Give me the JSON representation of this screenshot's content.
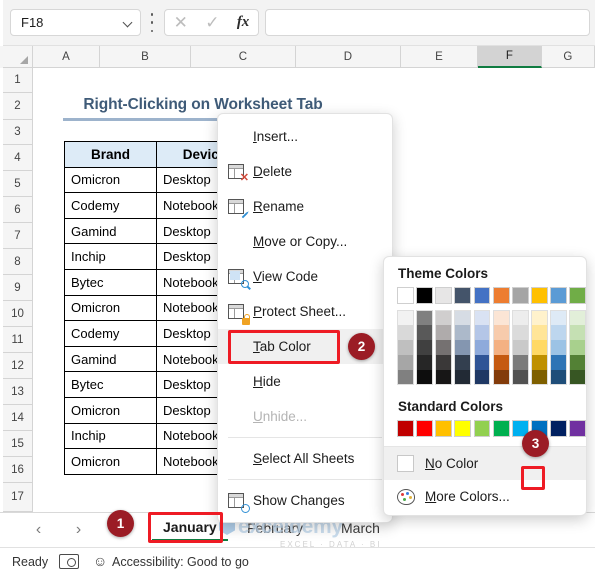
{
  "formula_bar": {
    "name_box_value": "F18",
    "formula_value": "",
    "cancel_icon": "x-icon",
    "enter_icon": "check-icon",
    "fx_label": "fx",
    "more_icon": "kebab-menu-icon"
  },
  "grid": {
    "columns": [
      "A",
      "B",
      "C",
      "D",
      "E",
      "F",
      "G"
    ],
    "selected_column": "F",
    "rows": [
      "1",
      "2",
      "3",
      "4",
      "5",
      "6",
      "7",
      "8",
      "9",
      "10",
      "11",
      "12",
      "13",
      "14",
      "15",
      "16",
      "17"
    ]
  },
  "sheet": {
    "title": "Right-Clicking on Worksheet Tab",
    "table": {
      "headers": [
        "Brand",
        "Device"
      ],
      "rows": [
        [
          "Omicron",
          "Desktop"
        ],
        [
          "Codemy",
          "Notebook"
        ],
        [
          "Gamind",
          "Desktop"
        ],
        [
          "Inchip",
          "Desktop"
        ],
        [
          "Bytec",
          "Notebook"
        ],
        [
          "Omicron",
          "Notebook"
        ],
        [
          "Codemy",
          "Desktop"
        ],
        [
          "Gamind",
          "Notebook"
        ],
        [
          "Bytec",
          "Desktop"
        ],
        [
          "Omicron",
          "Desktop"
        ],
        [
          "Inchip",
          "Notebook"
        ],
        [
          "Omicron",
          "Notebook"
        ]
      ]
    }
  },
  "context_menu": {
    "items": [
      {
        "label": "Insert...",
        "accel": "I",
        "icon": "insert-sheet-icon",
        "disabled": false,
        "highlighted": false,
        "has_icon": false
      },
      {
        "label": "Delete",
        "accel": "D",
        "icon": "delete-sheet-icon",
        "disabled": false,
        "highlighted": false,
        "has_icon": true
      },
      {
        "label": "Rename",
        "accel": "R",
        "icon": "rename-sheet-icon",
        "disabled": false,
        "highlighted": false,
        "has_icon": true
      },
      {
        "label": "Move or Copy...",
        "accel": "M",
        "icon": "move-copy-icon",
        "disabled": false,
        "highlighted": false,
        "has_icon": false
      },
      {
        "label": "View Code",
        "accel": "V",
        "icon": "view-code-icon",
        "disabled": false,
        "highlighted": false,
        "has_icon": true
      },
      {
        "label": "Protect Sheet...",
        "accel": "P",
        "icon": "protect-sheet-icon",
        "disabled": false,
        "highlighted": false,
        "has_icon": true
      },
      {
        "label": "Tab Color",
        "accel": "T",
        "icon": "tab-color-icon",
        "disabled": false,
        "highlighted": true,
        "has_icon": false
      },
      {
        "label": "Hide",
        "accel": "H",
        "icon": "hide-sheet-icon",
        "disabled": false,
        "highlighted": false,
        "has_icon": false
      },
      {
        "label": "Unhide...",
        "accel": "U",
        "icon": "unhide-sheet-icon",
        "disabled": true,
        "highlighted": false,
        "has_icon": false
      },
      {
        "label": "Select All Sheets",
        "accel": "S",
        "icon": "select-all-icon",
        "disabled": false,
        "highlighted": false,
        "has_icon": false
      },
      {
        "label": "Show Changes",
        "accel": "g",
        "icon": "show-changes-icon",
        "disabled": false,
        "highlighted": false,
        "has_icon": true
      }
    ]
  },
  "color_picker": {
    "theme_heading": "Theme Colors",
    "standard_heading": "Standard Colors",
    "no_color_label": "No Color",
    "more_colors_label": "More Colors...",
    "no_color_highlighted": true,
    "theme_base": [
      "#FFFFFF",
      "#000000",
      "#E7E6E6",
      "#44546A",
      "#4472C4",
      "#ED7D31",
      "#A5A5A5",
      "#FFC000",
      "#5B9BD5",
      "#70AD47"
    ],
    "theme_variants": [
      [
        "#F2F2F2",
        "#D9D9D9",
        "#BFBFBF",
        "#A6A6A6",
        "#808080"
      ],
      [
        "#808080",
        "#595959",
        "#404040",
        "#262626",
        "#0D0D0D"
      ],
      [
        "#D0CECE",
        "#AFABAB",
        "#757171",
        "#3A3838",
        "#171616"
      ],
      [
        "#D6DCE4",
        "#ACB9CA",
        "#8496B0",
        "#333F4F",
        "#222A35"
      ],
      [
        "#D9E2F3",
        "#B4C6E7",
        "#8EAADB",
        "#2F5496",
        "#1F3864"
      ],
      [
        "#FBE5D5",
        "#F7CBAC",
        "#F4B183",
        "#C55A11",
        "#833C0B"
      ],
      [
        "#EDEDED",
        "#DBDBDB",
        "#C9C9C9",
        "#7B7B7B",
        "#525252"
      ],
      [
        "#FFF2CC",
        "#FFE598",
        "#FFD965",
        "#BF9000",
        "#7F6000"
      ],
      [
        "#DEEAF6",
        "#BDD6EE",
        "#9CC3E5",
        "#2E74B5",
        "#1F4E79"
      ],
      [
        "#E2EFD9",
        "#C5E0B3",
        "#A8D08D",
        "#538135",
        "#375623"
      ]
    ],
    "standard_colors": [
      "#C00000",
      "#FF0000",
      "#FFC000",
      "#FFFF00",
      "#92D050",
      "#00B050",
      "#00B0F0",
      "#0070C0",
      "#002060",
      "#7030A0"
    ],
    "selected_standard_index": 7
  },
  "callouts": [
    {
      "number": "1",
      "target": "january-sheet-tab"
    },
    {
      "number": "2",
      "target": "tab-color-menu-item"
    },
    {
      "number": "3",
      "target": "standard-colors-swatch"
    }
  ],
  "tab_bar": {
    "prev_icon": "chevron-left-icon",
    "next_icon": "chevron-right-icon",
    "tabs": [
      {
        "label": "January",
        "active": true
      },
      {
        "label": "February",
        "active": false
      },
      {
        "label": "March",
        "active": false
      }
    ]
  },
  "status_bar": {
    "state": "Ready",
    "macro_icon": "record-macro-icon",
    "accessibility_icon": "accessibility-icon",
    "accessibility": "Accessibility: Good to go"
  },
  "watermark": {
    "brand": "exceldemy",
    "tagline": "EXCEL · DATA · BI",
    "logo_icon": "cube-logo-icon"
  }
}
